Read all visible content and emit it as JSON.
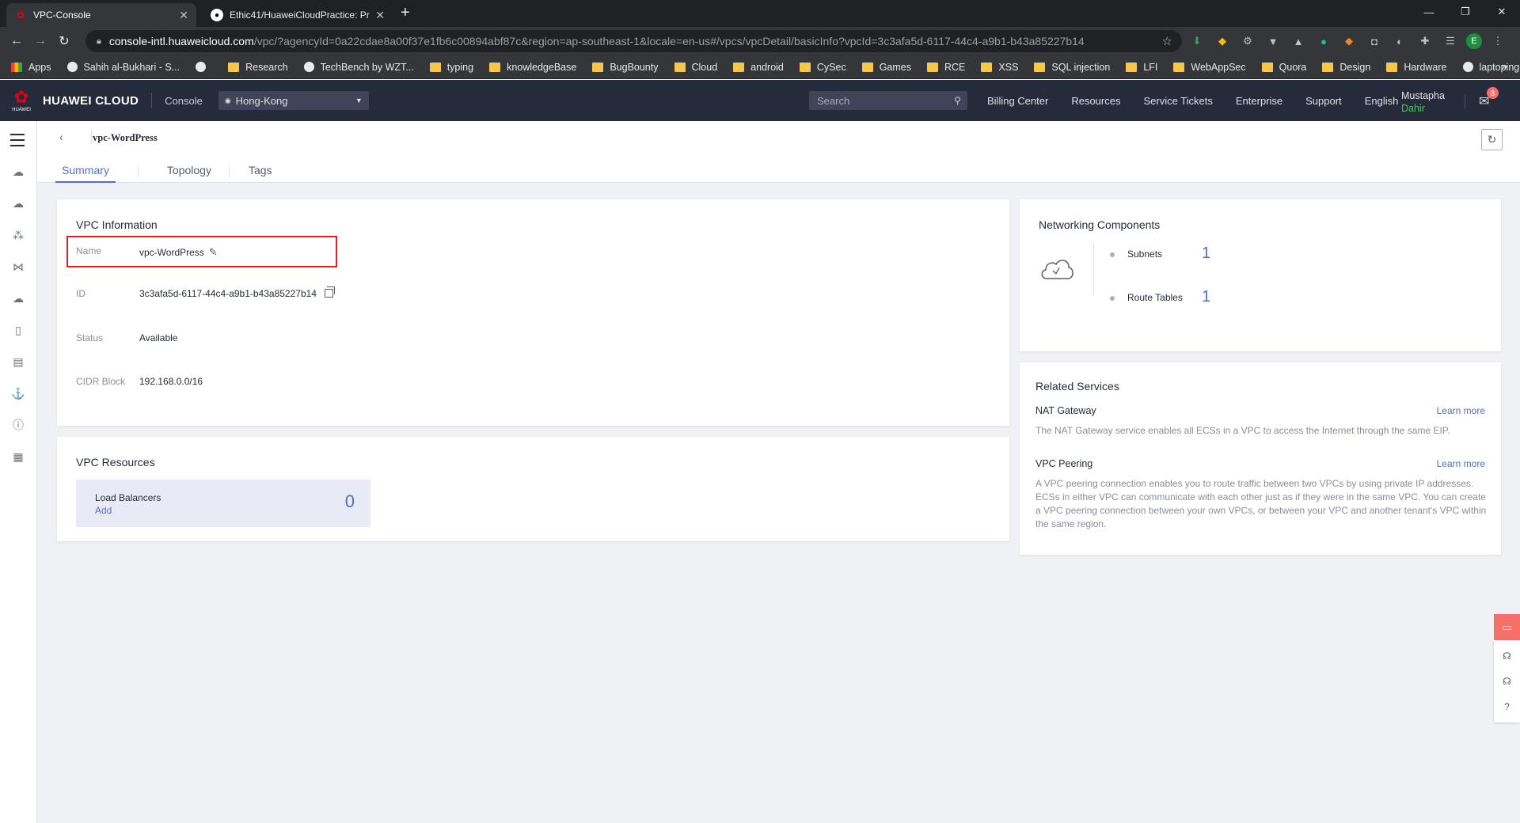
{
  "browser": {
    "tabs": [
      {
        "title": "VPC-Console",
        "icon": "huawei-favicon",
        "active": true
      },
      {
        "title": "Ethic41/HuaweiCloudPractice: Pr",
        "icon": "github-favicon",
        "active": false
      }
    ],
    "url_host": "console-intl.huaweicloud.com",
    "url_path": "/vpc/?agencyId=0a22cdae8a00f37e1fb6c00894abf87c&region=ap-southeast-1&locale=en-us#/vpcs/vpcDetail/basicInfo?vpcId=3c3afa5d-6117-44c4-a9b1-b43a85227b14",
    "profile_initial": "E",
    "bookmarks": [
      {
        "label": "Apps",
        "icon": "grid"
      },
      {
        "label": "Sahih al-Bukhari - S...",
        "icon": "globe"
      },
      {
        "label": "",
        "icon": "globe"
      },
      {
        "label": "Research",
        "icon": "folder"
      },
      {
        "label": "TechBench by WZT...",
        "icon": "globe"
      },
      {
        "label": "typing",
        "icon": "folder"
      },
      {
        "label": "knowledgeBase",
        "icon": "folder"
      },
      {
        "label": "BugBounty",
        "icon": "folder"
      },
      {
        "label": "Cloud",
        "icon": "folder"
      },
      {
        "label": "android",
        "icon": "folder"
      },
      {
        "label": "CySec",
        "icon": "folder"
      },
      {
        "label": "Games",
        "icon": "folder"
      },
      {
        "label": "RCE",
        "icon": "folder"
      },
      {
        "label": "XSS",
        "icon": "folder"
      },
      {
        "label": "SQL injection",
        "icon": "folder"
      },
      {
        "label": "LFI",
        "icon": "folder"
      },
      {
        "label": "WebAppSec",
        "icon": "folder"
      },
      {
        "label": "Quora",
        "icon": "folder"
      },
      {
        "label": "Design",
        "icon": "folder"
      },
      {
        "label": "Hardware",
        "icon": "folder"
      },
      {
        "label": "laptoping.com",
        "icon": "globe"
      }
    ]
  },
  "header": {
    "brand": "HUAWEI CLOUD",
    "logo_word": "HUAWEI",
    "console": "Console",
    "region": "Hong-Kong",
    "search_placeholder": "Search",
    "nav": [
      "Billing Center",
      "Resources",
      "Service Tickets",
      "Enterprise",
      "Support",
      "English"
    ],
    "user_name": "Mustapha",
    "user_sub": "Dahir",
    "mail_count": "8"
  },
  "page": {
    "breadcrumb": "vpc-WordPress",
    "tabs": [
      "Summary",
      "Topology",
      "Tags"
    ]
  },
  "vpc_info": {
    "title": "VPC Information",
    "name_label": "Name",
    "name_value": "vpc-WordPress",
    "id_label": "ID",
    "id_value": "3c3afa5d-6117-44c4-a9b1-b43a85227b14",
    "status_label": "Status",
    "status_value": "Available",
    "cidr_label": "CIDR Block",
    "cidr_value": "192.168.0.0/16"
  },
  "vpc_resources": {
    "title": "VPC Resources",
    "lb_label": "Load Balancers",
    "lb_add": "Add",
    "lb_count": "0"
  },
  "networking": {
    "title": "Networking Components",
    "subnets_label": "Subnets",
    "subnets_count": "1",
    "route_label": "Route Tables",
    "route_count": "1"
  },
  "related": {
    "title": "Related Services",
    "nat_name": "NAT Gateway",
    "nat_link": "Learn more",
    "nat_desc": "The NAT Gateway service enables all ECSs in a VPC to access the Internet through the same EIP.",
    "peer_name": "VPC Peering",
    "peer_link": "Learn more",
    "peer_desc": "A VPC peering connection enables you to route traffic between two VPCs by using private IP addresses. ECSs in either VPC can communicate with each other just as if they were in the same VPC. You can create a VPC peering connection between your own VPCs, or between your VPC and another tenant's VPC within the same region."
  },
  "colors": {
    "accent": "#526ecc",
    "header_bg": "#252b3a",
    "highlight": "#e02020",
    "feedback": "#f66f6a"
  }
}
